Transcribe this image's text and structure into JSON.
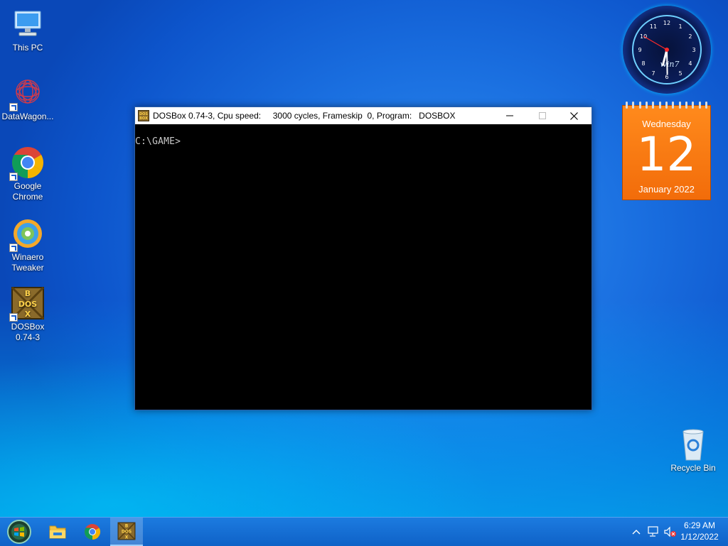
{
  "desktop": {
    "icons": [
      {
        "label_line1": "This PC",
        "label_line2": ""
      },
      {
        "label_line1": "DataWagon...",
        "label_line2": ""
      },
      {
        "label_line1": "Google",
        "label_line2": "Chrome"
      },
      {
        "label_line1": "Winaero",
        "label_line2": "Tweaker"
      },
      {
        "label_line1": "DOSBox",
        "label_line2": "0.74-3"
      },
      {
        "label_line1": "Recycle Bin",
        "label_line2": ""
      }
    ]
  },
  "window": {
    "title": "DOSBox 0.74-3, Cpu speed:     3000 cycles, Frameskip  0, Program:   DOSBOX",
    "icon_text": "DOS BOX",
    "prompt": "C:\\GAME>"
  },
  "gadgets": {
    "clock": {
      "brand": "win7",
      "hour_numbers": [
        "12",
        "1",
        "2",
        "3",
        "4",
        "5",
        "6",
        "7",
        "8",
        "9",
        "10",
        "11"
      ],
      "time_hours": 6,
      "time_minutes": 29,
      "time_seconds": 50
    },
    "calendar": {
      "day_name": "Wednesday",
      "date": "12",
      "month_year": "January 2022"
    }
  },
  "taskbar": {
    "time": "6:29 AM",
    "date": "1/12/2022"
  },
  "colors": {
    "accent": "#1a6fe0",
    "calendar": "#f26c0a",
    "taskbar": "#1273d6"
  }
}
